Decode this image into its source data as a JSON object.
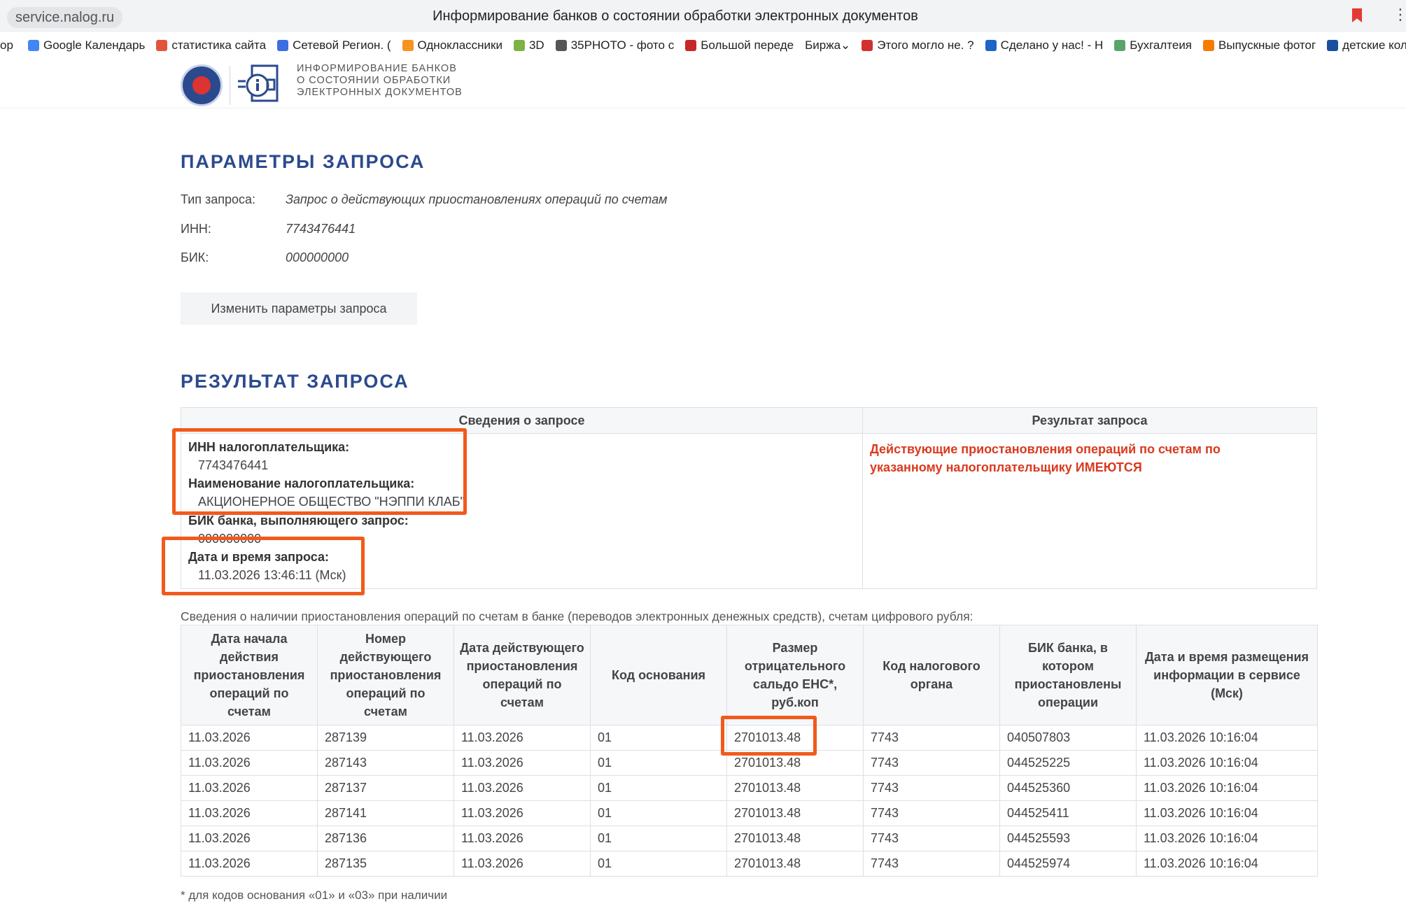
{
  "browser": {
    "url": "service.nalog.ru",
    "title": "Информирование банков о состоянии обработки электронных документов",
    "bookmarks": [
      {
        "label": "Google Календарь",
        "icon": "google-calendar-icon",
        "color": "#4285f4"
      },
      {
        "label": "статистика сайта",
        "icon": "stats-chart-icon",
        "color": "#e2553b"
      },
      {
        "label": "Сетевой Регион. (",
        "icon": "network-region-icon",
        "color": "#3b6ee2"
      },
      {
        "label": "Одноклассники",
        "icon": "odnoklassniki-icon",
        "color": "#f7931e"
      },
      {
        "label": "3D",
        "icon": "grid-3d-icon",
        "color": "#7cb342"
      },
      {
        "label": "35PHOTO - фото с",
        "icon": "photo-35-icon",
        "color": "#555555"
      },
      {
        "label": "Большой переде",
        "icon": "big-rework-icon",
        "color": "#c62828"
      },
      {
        "label": "Биржа",
        "icon": "exchange-dropdown-icon",
        "color": "#ffffff"
      },
      {
        "label": "Этого могло не. ?",
        "icon": "maybe-not-icon",
        "color": "#d32f2f"
      },
      {
        "label": "Сделано у нас! - Н",
        "icon": "made-here-icon",
        "color": "#1e63c6"
      },
      {
        "label": "Бухгалтеия",
        "icon": "accounting-icon",
        "color": "#5aa469"
      },
      {
        "label": "Выпускные фотог",
        "icon": "blogger-icon",
        "color": "#f57c00"
      },
      {
        "label": "детские колл",
        "icon": "s-letter-icon",
        "color": "#1a4fa0"
      }
    ]
  },
  "header": {
    "logo_lines": [
      "ИНФОРМИРОВАНИЕ БАНКОВ",
      "О СОСТОЯНИИ ОБРАБОТКИ",
      "ЭЛЕКТРОННЫХ ДОКУМЕНТОВ"
    ]
  },
  "params": {
    "heading": "ПАРАМЕТРЫ ЗАПРОСА",
    "type_label": "Тип запроса:",
    "type_value": "Запрос о действующих приостановлениях операций по счетам",
    "inn_label": "ИНН:",
    "inn_value": "7743476441",
    "bik_label": "БИК:",
    "bik_value": "000000000",
    "change_button": "Изменить параметры запроса"
  },
  "result": {
    "heading": "РЕЗУЛЬТАТ ЗАПРОСА",
    "col_request": "Сведения о запросе",
    "col_result": "Результат запроса",
    "inn_label": "ИНН налогоплательщика:",
    "inn_value": "7743476441",
    "name_label": "Наименование налогоплательщика:",
    "name_value": "АКЦИОНЕРНОЕ ОБЩЕСТВО \"НЭППИ КЛАБ\"",
    "bik_label": "БИК банка, выполняющего запрос:",
    "bik_value": "000000000",
    "datetime_label": "Дата и время запроса:",
    "datetime_value": "11.03.2026 13:46:11 (Мск)",
    "status_text": "Действующие приостановления операций по счетам по указанному налогоплательщику ИМЕЮТСЯ",
    "status_color": "#d93a1e"
  },
  "operations": {
    "caption": "Сведения о наличии приостановления операций по счетам в банке (переводов электронных денежных средств), счетам цифрового рубля:",
    "headers": [
      "Дата начала действия приостановления операций по счетам",
      "Номер действующего приостановления операций по счетам",
      "Дата действующего приостановления операций по счетам",
      "Код основания",
      "Размер отрицательного сальдо ЕНС*, руб.коп",
      "Код налогового органа",
      "БИК банка, в котором приостановлены операции",
      "Дата и время размещения информации в сервисе (Мск)"
    ],
    "rows": [
      [
        "11.03.2026",
        "287139",
        "11.03.2026",
        "01",
        "2701013.48",
        "7743",
        "040507803",
        "11.03.2026 10:16:04"
      ],
      [
        "11.03.2026",
        "287143",
        "11.03.2026",
        "01",
        "2701013.48",
        "7743",
        "044525225",
        "11.03.2026 10:16:04"
      ],
      [
        "11.03.2026",
        "287137",
        "11.03.2026",
        "01",
        "2701013.48",
        "7743",
        "044525360",
        "11.03.2026 10:16:04"
      ],
      [
        "11.03.2026",
        "287141",
        "11.03.2026",
        "01",
        "2701013.48",
        "7743",
        "044525411",
        "11.03.2026 10:16:04"
      ],
      [
        "11.03.2026",
        "287136",
        "11.03.2026",
        "01",
        "2701013.48",
        "7743",
        "044525593",
        "11.03.2026 10:16:04"
      ],
      [
        "11.03.2026",
        "287135",
        "11.03.2026",
        "01",
        "2701013.48",
        "7743",
        "044525974",
        "11.03.2026 10:16:04"
      ]
    ],
    "footnote": "* для кодов основания «01» и «03» при наличии"
  },
  "colors": {
    "brand_blue": "#2b4a8e",
    "highlight_orange": "#f15a1c"
  }
}
